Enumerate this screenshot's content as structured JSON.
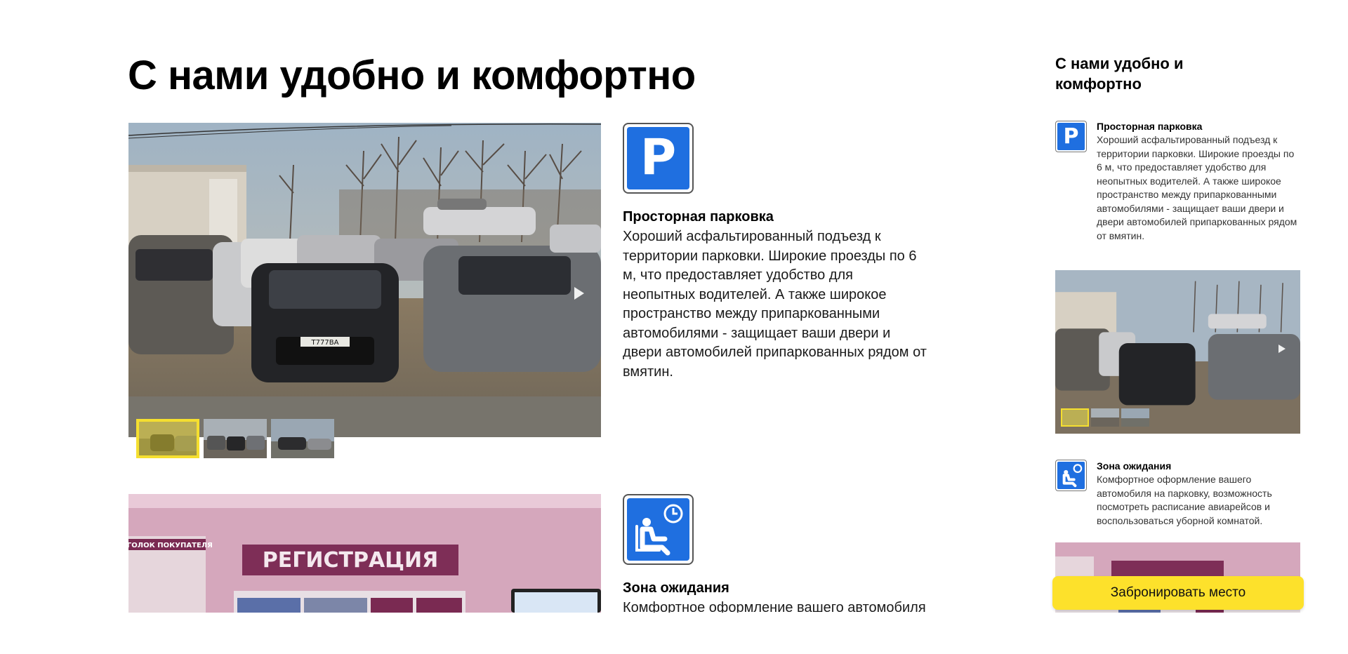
{
  "main": {
    "title": "С нами удобно и комфортно",
    "features": [
      {
        "icon": "parking-icon",
        "icon_glyph": "P",
        "title": "Просторная парковка",
        "text": "Хороший асфальтированный подъезд к территории парковки. Широкие проезды по 6 м, что предоставляет удобство для неопытных водителей. А также широкое пространство между припаркованными автомобилями - защищает ваши двери и двери автомобилей припаркованных рядом от вмятин.",
        "gallery_thumbnails": 3,
        "active_thumbnail": 1
      },
      {
        "icon": "waiting-room-icon",
        "title": "Зона ожидания",
        "text": "Комфортное оформление вашего автомобиля на парковку, возможность посмотреть расписание авиарейсов и воспользоваться уборной комнатой."
      }
    ]
  },
  "side": {
    "title": "С нами удобно и комфортно",
    "features": [
      {
        "title": "Просторная парковка",
        "text": "Хороший асфальтированный подъезд к территории парковки. Широкие проезды по 6 м, что предоставляет удобство для неопытных водителей. А также широкое пространство между припаркованными автомобилями - защищает ваши двери и двери автомобилей припаркованных рядом от вмятин."
      },
      {
        "title": "Зона ожидания",
        "text": "Комфортное оформление вашего автомобиля на парковку, возможность посмотреть расписание авиарейсов и воспользоваться уборной комнатой."
      }
    ]
  },
  "photo_signs": {
    "plate": "Т777ВА",
    "shop_corner": "УГОЛОК ПОКУПАТЕЛЯ",
    "registration": "РЕГИСТРАЦИЯ"
  },
  "cta": {
    "label": "Забронировать место"
  },
  "colors": {
    "accent_yellow": "#fde12b",
    "icon_blue": "#1f6fe0",
    "thumb_highlight": "#f5df2f"
  }
}
